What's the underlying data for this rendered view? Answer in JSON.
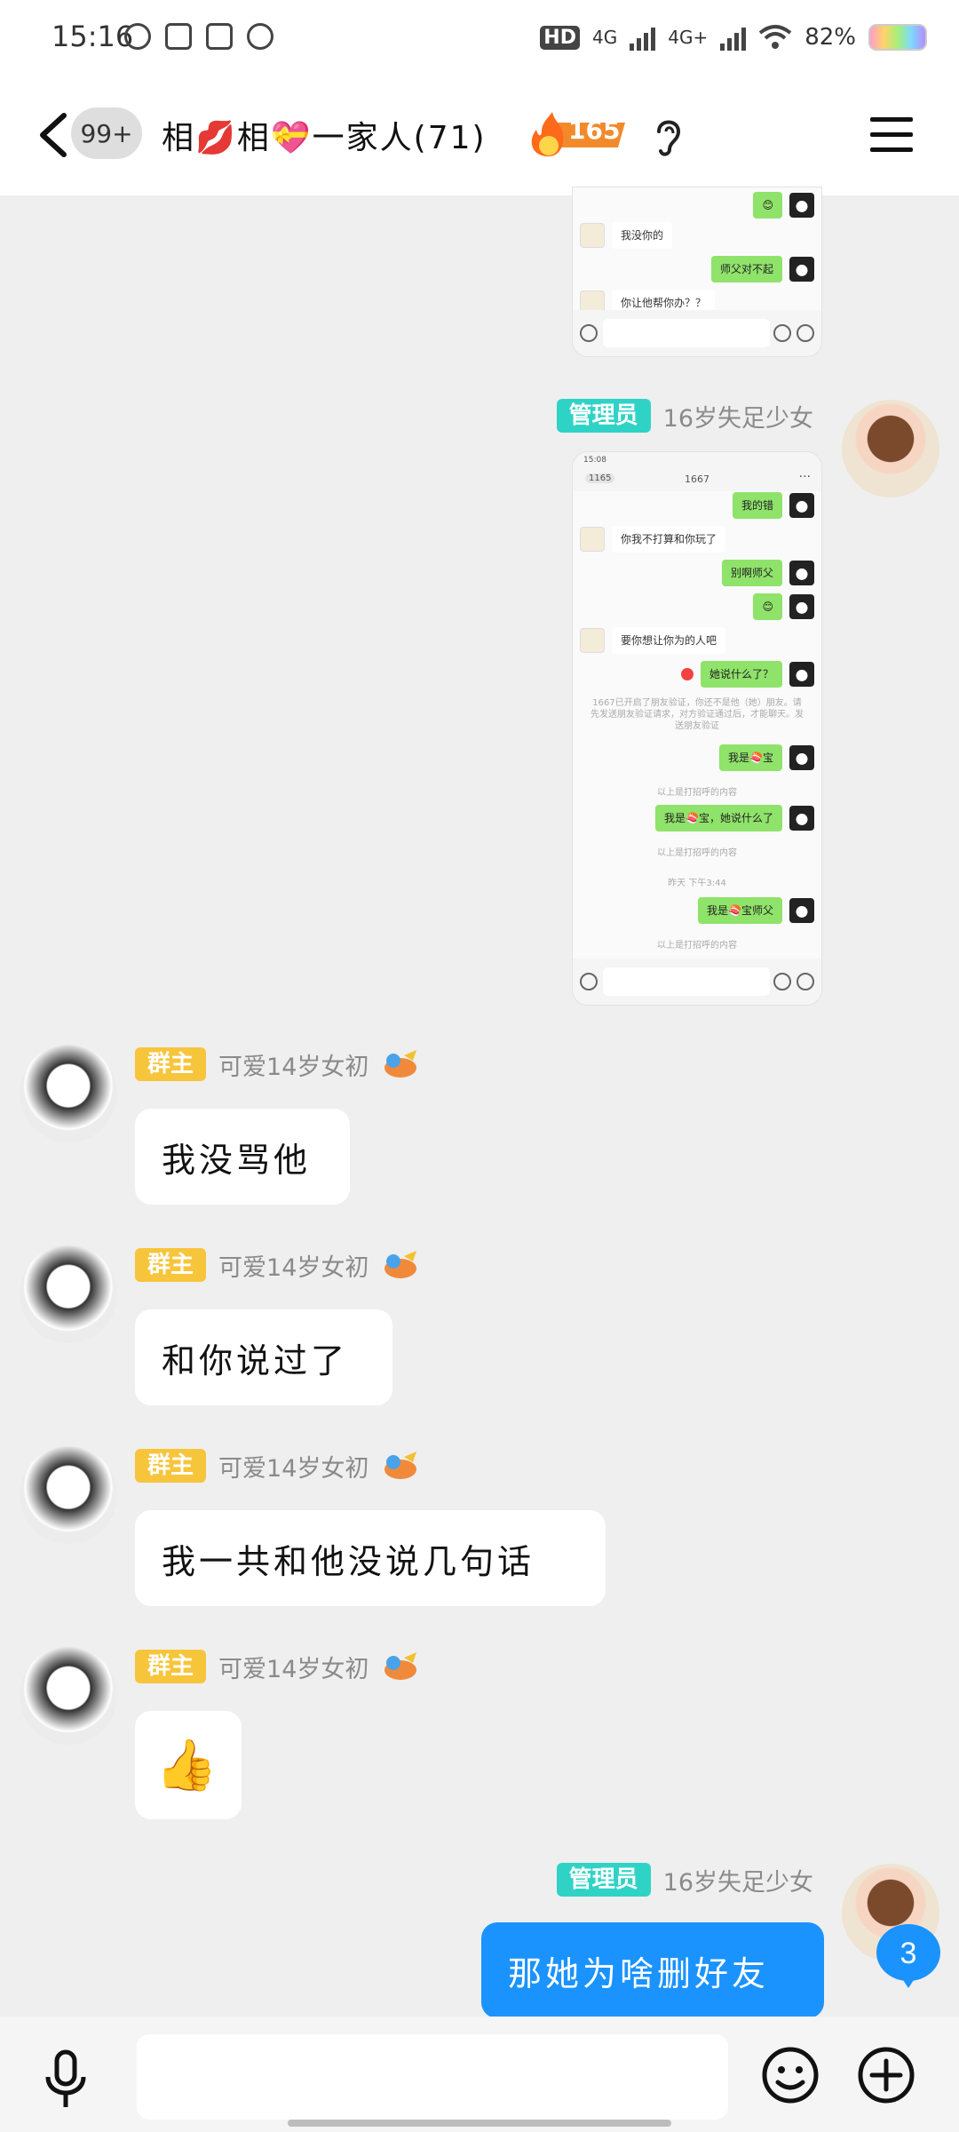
{
  "status_bar": {
    "time": "15:16",
    "network": "HD",
    "sim1": "4G",
    "sim2": "4G+",
    "battery": "82%",
    "app_icons": [
      "leaf-icon",
      "national-icon",
      "taobao-icon",
      "globe-icon"
    ]
  },
  "header": {
    "unread": "99+",
    "title": "相💋相💝一家人(71)",
    "fire_count": "165",
    "icons": [
      "back-icon",
      "fire-icon",
      "ear-icon",
      "menu-icon"
    ]
  },
  "shot1": {
    "rows": [
      {
        "text": "我没你的",
        "dir": "in"
      },
      {
        "text": "师父对不起",
        "dir": "out"
      },
      {
        "text": "你让他帮你办？？",
        "dir": "in"
      }
    ]
  },
  "shot2": {
    "top_time": "15:08",
    "top_back": "1165",
    "top_title": "1667",
    "rows": [
      {
        "text": "我的错",
        "dir": "out"
      },
      {
        "text": "你我不打算和你玩了",
        "dir": "in"
      },
      {
        "text": "别啊师父",
        "dir": "out"
      },
      {
        "text": "😊",
        "dir": "out"
      },
      {
        "text": "要你想让你为的人吧",
        "dir": "in"
      },
      {
        "text": "她说什么了？",
        "dir": "out"
      }
    ],
    "system_note": "1667已开启了朋友验证，你还不是他（她）朋友。请先发送朋友验证请求，对方验证通过后，才能聊天。发送朋友验证",
    "rows2": [
      {
        "text": "我是🍣宝",
        "dir": "out"
      },
      {
        "text": "我是🍣宝，她说什么了",
        "dir": "out"
      }
    ],
    "time_note": "昨天 下午3:44",
    "rows3": [
      {
        "text": "我是🍣宝师父",
        "dir": "out"
      }
    ],
    "history_note": "以上是打招呼的内容"
  },
  "senders": {
    "owner_role": "群主",
    "owner_name": "可爱14岁女初",
    "admin_role": "管理员",
    "admin_name": "16岁失足少女"
  },
  "messages": [
    {
      "text": "我没骂他"
    },
    {
      "text": "和你说过了"
    },
    {
      "text": "我一共和他没说几句话"
    },
    {
      "text": "👍"
    },
    {
      "text": "那她为啥删好友"
    }
  ],
  "unread_pin": "3",
  "input": {
    "placeholder": ""
  },
  "colors": {
    "owner_badge": "#f7c53b",
    "admin_badge": "#2fd3c6",
    "out_bubble": "#1a93ff",
    "background": "#efefef"
  }
}
